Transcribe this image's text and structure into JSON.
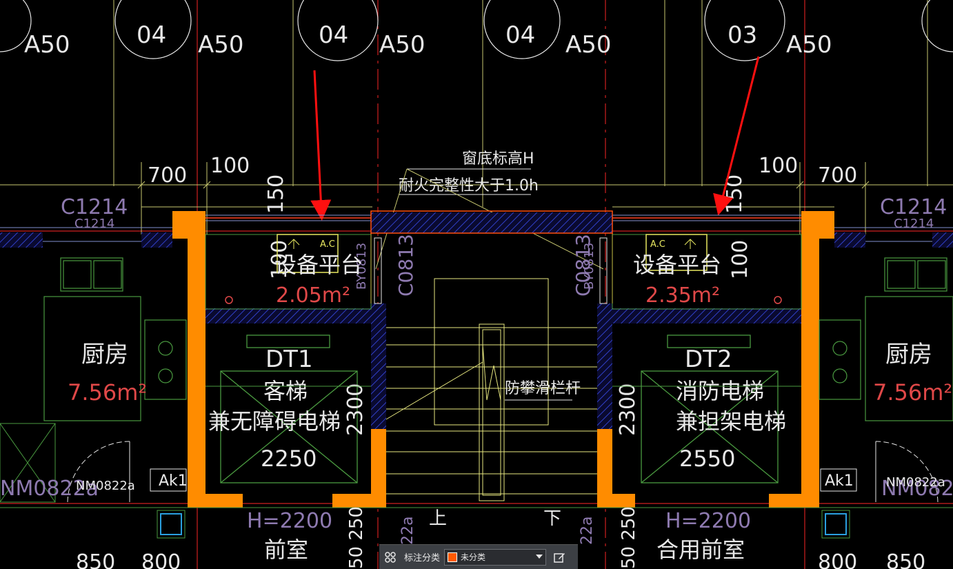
{
  "colors": {
    "background": "#000000",
    "wall_orange": "#ff8c00",
    "red_axis": "#e0202a",
    "yellow_line": "#e8e880",
    "green_line": "#4a9a40",
    "white_text": "#e8e8e8",
    "red_text": "#e04848",
    "purple_text": "#8e7ab0",
    "hatch_blue": "#2a38b8",
    "arrow_red": "#ff1010",
    "swatch": "#ff5a00"
  },
  "drawing": {
    "top_labels": [
      "A50",
      "A50",
      "A50",
      "A50",
      "A50"
    ],
    "circle_labels": [
      "04",
      "04",
      "04",
      "03"
    ],
    "dimensions": {
      "left_700": "700",
      "left_100": "100",
      "right_100": "100",
      "right_700": "700",
      "dim_150_left": "150",
      "dim_150_right": "150",
      "dim_100_right": "100",
      "height_2300_left": "2300",
      "height_2300_right": "2300",
      "width_2250": "2250",
      "width_2550": "2550",
      "bottom_850_left": "850",
      "bottom_800_left": "800",
      "bottom_800_right": "800",
      "bottom_850_right": "850",
      "bottom_250_left": "50 250",
      "bottom_250_right": "50 250"
    },
    "annotation_window_sill": "窗底标高H",
    "annotation_fire_integrity": "耐火完整性大于1.0h",
    "window_labels": {
      "c1214_left": "C1214",
      "c1214_left_small": "C1214",
      "c1214_right": "C1214",
      "c1214_right_small": "C1214",
      "by0813_left": "BY0813",
      "c0813_left": "C0813",
      "c0813_right": "C0813",
      "by0813_right": "BY0813"
    },
    "ac_label": "A.C",
    "rooms": {
      "equip_left_name": "设备平台",
      "equip_left_area": "2.05m²",
      "equip_right_name": "设备平台",
      "equip_right_area": "2.35m²",
      "kitchen_left_name": "厨房",
      "kitchen_left_area": "7.56m²",
      "kitchen_right_name": "厨房",
      "kitchen_right_area": "7.56m²",
      "dt1": "DT1",
      "dt1_line1": "客梯",
      "dt1_line2": "兼无障碍电梯",
      "dt2": "DT2",
      "dt2_line1": "消防电梯",
      "dt2_line2": "兼担架电梯",
      "anti_climb": "防攀滑栏杆",
      "stair_up": "上",
      "stair_down": "下",
      "front_room": "前室",
      "shared_front_room": "合用前室",
      "h2200_left": "H=2200",
      "h2200_right": "H=2200"
    },
    "doors": {
      "nm_left": "NM0822a",
      "nm_left_small": "NM0822a",
      "nm_right": "NM0822a",
      "nm_right_small": "NM0822a",
      "ak_left": "Ak1",
      "ak_right": "Ak1",
      "fm_left": "22a",
      "fm_right": "22a"
    }
  },
  "toolbar": {
    "grid_icon": "grid-icon",
    "label": "标注分类",
    "selected": "未分类",
    "dropdown_icon": "chevron-down-icon",
    "edit_icon": "edit-icon"
  }
}
